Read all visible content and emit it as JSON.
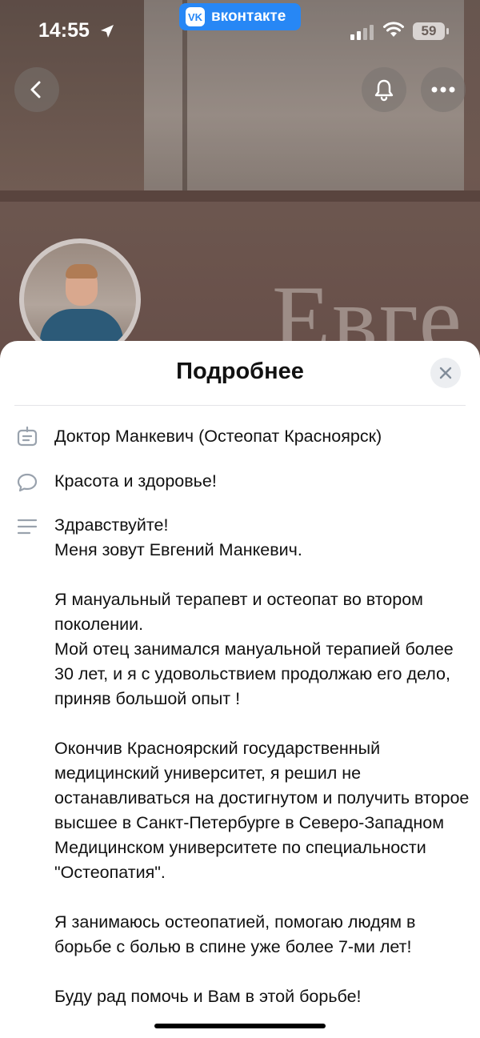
{
  "status_bar": {
    "time": "14:55",
    "app_pill": "вконтакте",
    "vk_logo": "VK",
    "battery": "59"
  },
  "cover": {
    "word": "Евге"
  },
  "header": {
    "back_icon": "chevron-left-icon",
    "bell_icon": "bell-icon",
    "more_icon": "more-horizontal-icon"
  },
  "sheet": {
    "title": "Подробнее",
    "close_icon": "close-icon",
    "rows": [
      {
        "icon": "badge-icon",
        "text": "Доктор Манкевич (Остеопат Красноярск)"
      },
      {
        "icon": "speech-bubble-icon",
        "text": "Красота и здоровье!"
      }
    ],
    "description": {
      "icon": "lines-icon",
      "paragraphs": [
        "Здравствуйте!\nМеня зовут Евгений Манкевич.",
        "Я мануальный терапевт и остеопат во втором поколении.\nМой отец занимался мануальной терапией более 30 лет, и я с удовольствием продолжаю его дело, приняв большой опыт !",
        "Окончив Красноярский государственный медицинский университет, я решил не останавливаться на достигнутом и получить второе высшее в Санкт-Петербурге в Северо-Западном Медицинском университете по специальности \"Остеопатия\".",
        "Я занимаюсь остеопатией, помогаю людям в борьбе с болью в спине уже более 7-ми лет!",
        "Буду рад помочь и Вам в этой борьбе!"
      ]
    }
  },
  "colors": {
    "vk_blue": "#2787f5",
    "icon_gray": "#99a2ad"
  }
}
